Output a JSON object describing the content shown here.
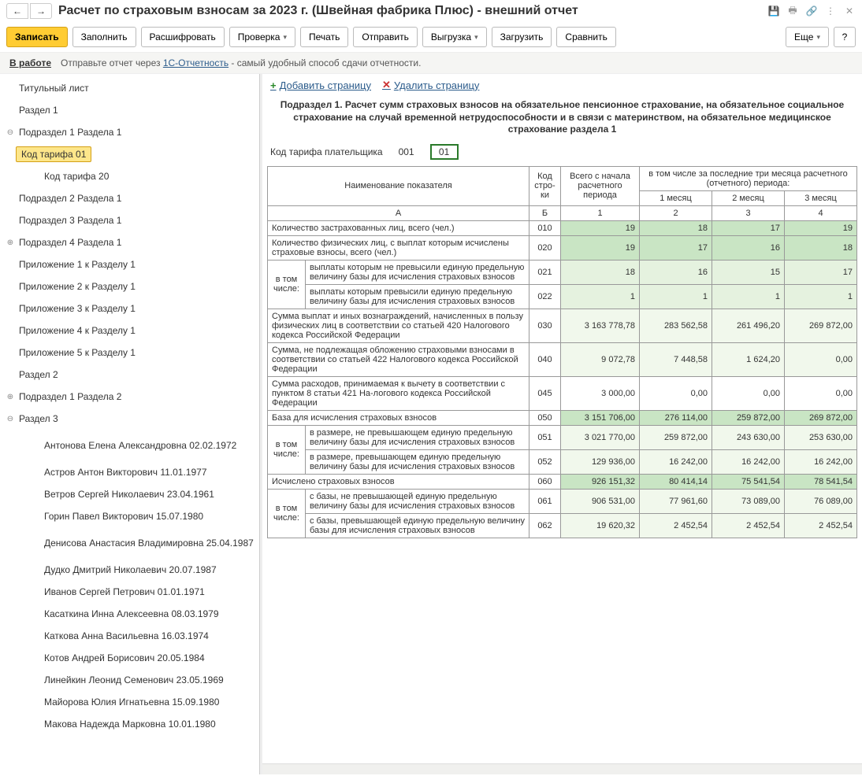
{
  "title": "Расчет по страховым взносам за 2023 г. (Швейная фабрика Плюс) - внешний отчет",
  "toolbar": {
    "save": "Записать",
    "fill": "Заполнить",
    "decode": "Расшифровать",
    "check": "Проверка",
    "print": "Печать",
    "send": "Отправить",
    "export": "Выгрузка",
    "import": "Загрузить",
    "compare": "Сравнить",
    "more": "Еще",
    "help": "?"
  },
  "status": {
    "label": "В работе",
    "hint_prefix": "Отправьте отчет через ",
    "hint_link": "1С-Отчетность",
    "hint_suffix": " - самый удобный способ сдачи отчетности."
  },
  "tree": [
    {
      "label": "Титульный лист",
      "indent": 0
    },
    {
      "label": "Раздел 1",
      "indent": 0
    },
    {
      "label": "Подраздел 1 Раздела 1",
      "indent": 0,
      "exp": "⊖"
    },
    {
      "label": "Код тарифа 01",
      "indent": 2,
      "selected": true
    },
    {
      "label": "Код тарифа 20",
      "indent": 2
    },
    {
      "label": "Подраздел 2 Раздела 1",
      "indent": 0
    },
    {
      "label": "Подраздел 3 Раздела 1",
      "indent": 0
    },
    {
      "label": "Подраздел 4 Раздела 1",
      "indent": 0,
      "exp": "⊕"
    },
    {
      "label": "Приложение 1 к Разделу 1",
      "indent": 0
    },
    {
      "label": "Приложение 2 к Разделу 1",
      "indent": 0
    },
    {
      "label": "Приложение 3 к Разделу 1",
      "indent": 0
    },
    {
      "label": "Приложение 4 к Разделу 1",
      "indent": 0
    },
    {
      "label": "Приложение 5 к Разделу 1",
      "indent": 0
    },
    {
      "label": "Раздел 2",
      "indent": 0
    },
    {
      "label": "Подраздел 1 Раздела 2",
      "indent": 0,
      "exp": "⊕"
    },
    {
      "label": "Раздел 3",
      "indent": 0,
      "exp": "⊖"
    },
    {
      "label": "Антонова Елена Александровна 02.02.1972",
      "indent": 2,
      "twoLine": true
    },
    {
      "label": "Астров Антон Викторович 11.01.1977",
      "indent": 2
    },
    {
      "label": "Ветров Сергей Николаевич 23.04.1961",
      "indent": 2
    },
    {
      "label": "Горин Павел Викторович 15.07.1980",
      "indent": 2
    },
    {
      "label": "Денисова Анастасия Владимировна 25.04.1987",
      "indent": 2,
      "twoLine": true
    },
    {
      "label": "Дудко Дмитрий Николаевич 20.07.1987",
      "indent": 2
    },
    {
      "label": "Иванов Сергей Петрович 01.01.1971",
      "indent": 2
    },
    {
      "label": "Касаткина Инна Алексеевна 08.03.1979",
      "indent": 2
    },
    {
      "label": "Каткова Анна Васильевна 16.03.1974",
      "indent": 2
    },
    {
      "label": "Котов Андрей Борисович 20.05.1984",
      "indent": 2
    },
    {
      "label": "Линейкин Леонид Семенович 23.05.1969",
      "indent": 2
    },
    {
      "label": "Майорова Юлия Игнатьевна 15.09.1980",
      "indent": 2
    },
    {
      "label": "Макова Надежда Марковна 10.01.1980",
      "indent": 2
    }
  ],
  "content_toolbar": {
    "add": "Добавить страницу",
    "del": "Удалить страницу"
  },
  "section_header": "Подраздел 1. Расчет сумм страховых взносов на обязательное пенсионное страхование, на обязательное социальное страхование на случай временной нетрудоспособности и в связи с материнством, на обязательное медицинское страхование раздела 1",
  "tariff": {
    "label": "Код тарифа плательщика",
    "code": "001",
    "value": "01"
  },
  "grid": {
    "headers": {
      "name": "Наименование показателя",
      "rowcode": "Код стро-ки",
      "total": "Всего с начала расчетного периода",
      "last3": "в том числе за последние три месяца расчетного (отчетного) периода:",
      "m1": "1 месяц",
      "m2": "2 месяц",
      "m3": "3 месяц",
      "colA": "А",
      "colB": "Б",
      "c1": "1",
      "c2": "2",
      "c3": "3",
      "c4": "4"
    },
    "in_that": "в том числе:",
    "rows": [
      {
        "cls": "green",
        "label": "Количество застрахованных лиц, всего (чел.)",
        "code": "010",
        "v": [
          "19",
          "18",
          "17",
          "19"
        ]
      },
      {
        "cls": "green",
        "label": "Количество физических лиц, с выплат которым исчислены страховые взносы, всего (чел.)",
        "code": "020",
        "v": [
          "19",
          "17",
          "16",
          "18"
        ]
      },
      {
        "cls": "lightgreen",
        "label": "выплаты которым не превысили единую предельную величину базы для исчисления страховых взносов",
        "code": "021",
        "v": [
          "18",
          "16",
          "15",
          "17"
        ],
        "sub": true,
        "group": "g1"
      },
      {
        "cls": "lightgreen",
        "label": "выплаты которым превысили единую предельную величину базы для исчисления страховых взносов",
        "code": "022",
        "v": [
          "1",
          "1",
          "1",
          "1"
        ],
        "sub": true
      },
      {
        "cls": "palegreen",
        "label": "Сумма выплат и иных вознаграждений, начисленных в пользу физических лиц в соответствии со статьей 420 Налогового кодекса Российской Федерации",
        "code": "030",
        "v": [
          "3 163 778,78",
          "283 562,58",
          "261 496,20",
          "269 872,00"
        ]
      },
      {
        "cls": "palegreen",
        "label": "Сумма, не подлежащая обложению страховыми взносами в соответствии со статьей 422 Налогового кодекса Российской Федерации",
        "code": "040",
        "v": [
          "9 072,78",
          "7 448,58",
          "1 624,20",
          "0,00"
        ]
      },
      {
        "cls": "white",
        "label": "Сумма расходов, принимаемая к вычету в соответствии с пунктом 8 статьи 421 На-логового кодекса Российской Федерации",
        "code": "045",
        "v": [
          "3 000,00",
          "0,00",
          "0,00",
          "0,00"
        ]
      },
      {
        "cls": "green",
        "label": "База для исчисления страховых взносов",
        "code": "050",
        "v": [
          "3 151 706,00",
          "276 114,00",
          "259 872,00",
          "269 872,00"
        ]
      },
      {
        "cls": "palegreen",
        "label": "в размере, не превышающем единую предельную величину базы для исчисления страховых взносов",
        "code": "051",
        "v": [
          "3 021 770,00",
          "259 872,00",
          "243 630,00",
          "253 630,00"
        ],
        "sub": true,
        "group": "g2"
      },
      {
        "cls": "palegreen",
        "label": "в размере, превышающем единую предельную величину базы для исчисления страховых взносов",
        "code": "052",
        "v": [
          "129 936,00",
          "16 242,00",
          "16 242,00",
          "16 242,00"
        ],
        "sub": true
      },
      {
        "cls": "green",
        "label": "Исчислено страховых взносов",
        "code": "060",
        "v": [
          "926 151,32",
          "80 414,14",
          "75 541,54",
          "78 541,54"
        ]
      },
      {
        "cls": "palegreen",
        "label": "с базы, не превышающей единую предельную величину базы для исчисления страховых взносов",
        "code": "061",
        "v": [
          "906 531,00",
          "77 961,60",
          "73 089,00",
          "76 089,00"
        ],
        "sub": true,
        "group": "g3"
      },
      {
        "cls": "palegreen",
        "label": "с базы, превышающей единую предельную величину базы для исчисления страховых взносов",
        "code": "062",
        "v": [
          "19 620,32",
          "2 452,54",
          "2 452,54",
          "2 452,54"
        ],
        "sub": true
      }
    ]
  }
}
